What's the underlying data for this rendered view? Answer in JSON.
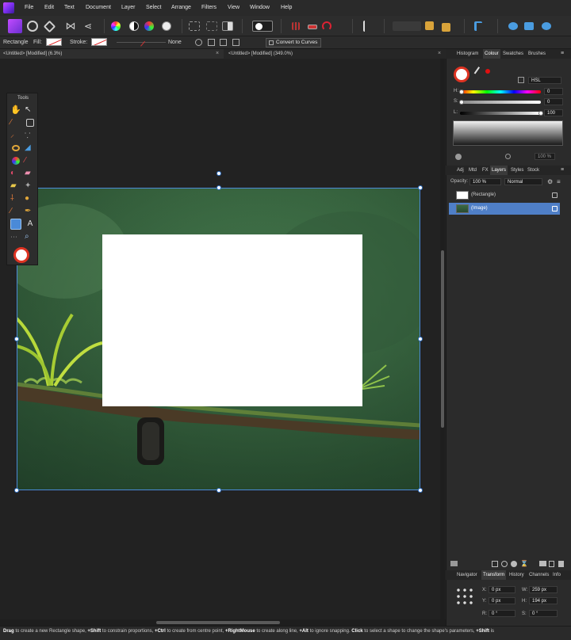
{
  "menu": {
    "items": [
      "File",
      "Edit",
      "Text",
      "Document",
      "Layer",
      "Select",
      "Arrange",
      "Filters",
      "View",
      "Window",
      "Help"
    ]
  },
  "context_bar": {
    "tool_name": "Rectangle",
    "fill_label": "Fill:",
    "stroke_label": "Stroke:",
    "stroke_width_value": "None",
    "convert_button": "Convert to Curves"
  },
  "doc_tabs": [
    {
      "label": "<Untitled> [Modified] (6.3%)"
    },
    {
      "label": "<Untitled> [Modified] (349.0%)"
    }
  ],
  "tools_panel": {
    "title": "Tools"
  },
  "colour_panel": {
    "tabs": [
      "Histogram",
      "Colour",
      "Swatches",
      "Brushes"
    ],
    "active_tab": "Colour",
    "model": "HSL",
    "h_label": "H:",
    "h_value": "0",
    "s_label": "S:",
    "s_value": "0",
    "l_label": "L:",
    "l_value": "100",
    "opacity_value": "100 %"
  },
  "layers_panel": {
    "tabs": [
      "Adj",
      "Mtd",
      "FX",
      "Layers",
      "Styles",
      "Stock"
    ],
    "active_tab": "Layers",
    "opacity_label": "Opacity:",
    "opacity_value": "100 %",
    "blend_mode": "Normal",
    "layers": [
      {
        "name": "(Rectangle)",
        "selected": false
      },
      {
        "name": "(Image)",
        "selected": true
      }
    ]
  },
  "transform_panel": {
    "tabs": [
      "Navigator",
      "Transform",
      "History",
      "Channels",
      "Info"
    ],
    "active_tab": "Transform",
    "x_label": "X:",
    "x_value": "0 px",
    "y_label": "Y:",
    "y_value": "0 px",
    "w_label": "W:",
    "w_value": "259 px",
    "h_label": "H:",
    "h_value": "194 px",
    "r_label": "R:",
    "r_value": "0 °",
    "s_label": "S:",
    "s_value": "0 °"
  },
  "status_bar": {
    "segments": [
      {
        "bold": "Drag",
        "text": " to create a new Rectangle shape, "
      },
      {
        "bold": "+Shift",
        "text": " to constrain proportions, "
      },
      {
        "bold": "+Ctrl",
        "text": " to create from centre point, "
      },
      {
        "bold": "+RightMouse",
        "text": " to create along line, "
      },
      {
        "bold": "+Alt",
        "text": " to ignore snapping. "
      },
      {
        "bold": "Click",
        "text": " to select a shape to change the shape's parameters, "
      },
      {
        "bold": "+Shift",
        "text": " is"
      }
    ]
  },
  "colors": {
    "accent": "#4a8ad8",
    "selected_layer": "#4f7fc7",
    "background": "#232323",
    "panel": "#2b2b2b"
  },
  "icons": [
    "affinity-photo-logo",
    "hand-icon",
    "move-icon",
    "crop-icon",
    "brush-icon",
    "eraser-icon",
    "fill-icon",
    "text-icon",
    "zoom-icon",
    "colour-picker-icon",
    "gear-icon"
  ]
}
